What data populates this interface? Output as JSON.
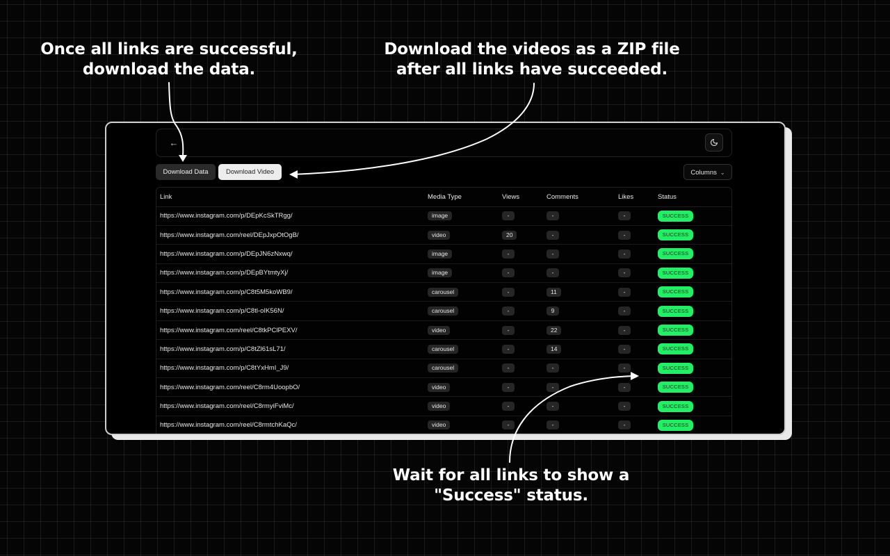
{
  "callouts": {
    "left": [
      "Once all links are successful,",
      "download the data."
    ],
    "center": [
      "Download the videos as a ZIP file",
      "after all links have succeeded."
    ],
    "bottom": [
      "Wait for all links to show a",
      "\"Success\" status."
    ]
  },
  "topbar": {
    "back_icon": "arrow-left-icon",
    "theme_icon": "moon-icon"
  },
  "toolbar": {
    "download_data": "Download Data",
    "download_video": "Download Video",
    "columns": "Columns",
    "columns_icon": "chevron-down-icon"
  },
  "table": {
    "headers": [
      "Link",
      "Media Type",
      "Views",
      "Comments",
      "Likes",
      "Status"
    ],
    "rows": [
      {
        "link": "https://www.instagram.com/p/DEpKcSkTRgg/",
        "media_type": "image",
        "views": "-",
        "comments": "-",
        "likes": "-",
        "status": "SUCCESS"
      },
      {
        "link": "https://www.instagram.com/reel/DEpJxpOtOgB/",
        "media_type": "video",
        "views": "20",
        "comments": "-",
        "likes": "-",
        "status": "SUCCESS"
      },
      {
        "link": "https://www.instagram.com/p/DEpJN6zNxwq/",
        "media_type": "image",
        "views": "-",
        "comments": "-",
        "likes": "-",
        "status": "SUCCESS"
      },
      {
        "link": "https://www.instagram.com/p/DEpBYtmtyXj/",
        "media_type": "image",
        "views": "-",
        "comments": "-",
        "likes": "-",
        "status": "SUCCESS"
      },
      {
        "link": "https://www.instagram.com/p/C8t5M5koWB9/",
        "media_type": "carousel",
        "views": "-",
        "comments": "11",
        "likes": "-",
        "status": "SUCCESS"
      },
      {
        "link": "https://www.instagram.com/p/C8tl-oIK56N/",
        "media_type": "carousel",
        "views": "-",
        "comments": "9",
        "likes": "-",
        "status": "SUCCESS"
      },
      {
        "link": "https://www.instagram.com/reel/C8tkPClPEXV/",
        "media_type": "video",
        "views": "-",
        "comments": "22",
        "likes": "-",
        "status": "SUCCESS"
      },
      {
        "link": "https://www.instagram.com/p/C8tZl61sL71/",
        "media_type": "carousel",
        "views": "-",
        "comments": "14",
        "likes": "-",
        "status": "SUCCESS"
      },
      {
        "link": "https://www.instagram.com/p/C8tYxHmI_J9/",
        "media_type": "carousel",
        "views": "-",
        "comments": "-",
        "likes": "-",
        "status": "SUCCESS"
      },
      {
        "link": "https://www.instagram.com/reel/C8rm4UoopbO/",
        "media_type": "video",
        "views": "-",
        "comments": "-",
        "likes": "-",
        "status": "SUCCESS"
      },
      {
        "link": "https://www.instagram.com/reel/C8rmyiFviMc/",
        "media_type": "video",
        "views": "-",
        "comments": "-",
        "likes": "-",
        "status": "SUCCESS"
      },
      {
        "link": "https://www.instagram.com/reel/C8rmtchKaQc/",
        "media_type": "video",
        "views": "-",
        "comments": "-",
        "likes": "-",
        "status": "SUCCESS"
      }
    ]
  },
  "colors": {
    "background": "#050505",
    "success": "#22ee66",
    "frame_border": "#cfcfcf"
  }
}
